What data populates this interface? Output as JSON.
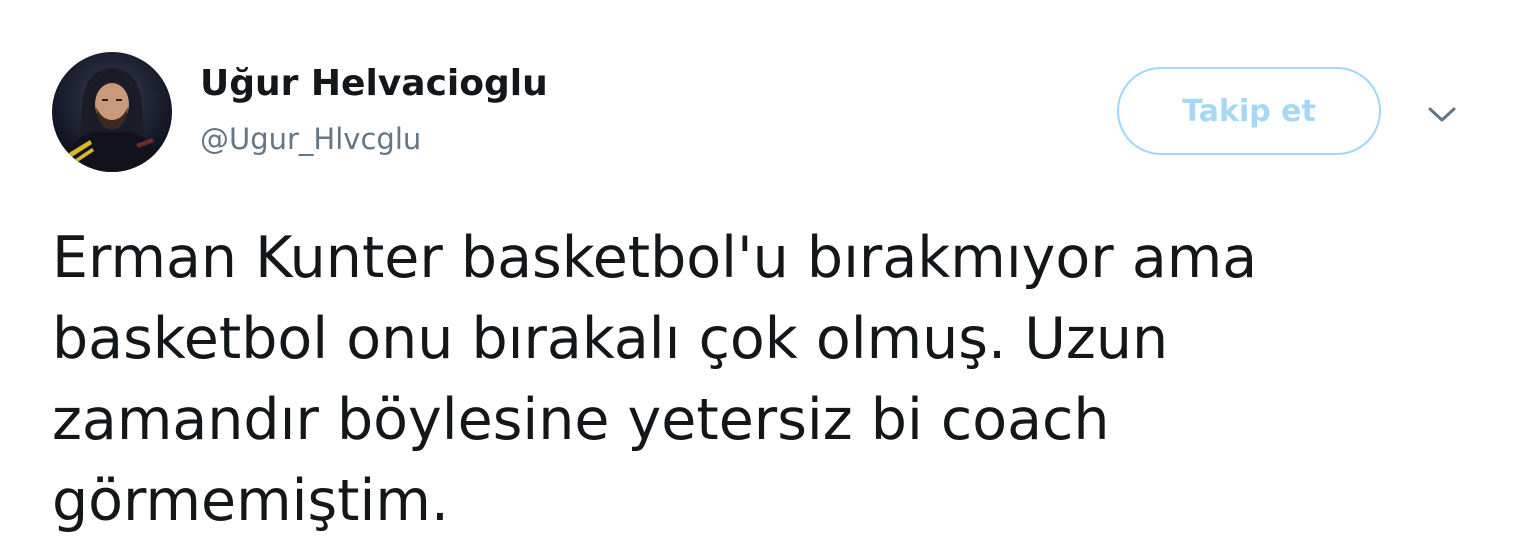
{
  "tweet": {
    "author": {
      "fullname": "Uğur Helvacioglu",
      "handle": "@Ugur_Hlvcglu",
      "avatar_icon": "profile-photo"
    },
    "follow_button_label": "Takip et",
    "menu_icon": "chevron-down-icon",
    "text_lines": [
      "Erman Kunter basketbol'u bırakmıyor ama",
      "basketbol onu bırakalı çok olmuş. Uzun",
      "zamandır böylesine yetersiz bi coach",
      "görmemiştim."
    ]
  },
  "colors": {
    "text": "#14171a",
    "secondary_text": "#657786",
    "follow_border": "#9fd7f7",
    "follow_text": "#a6d7f5"
  }
}
